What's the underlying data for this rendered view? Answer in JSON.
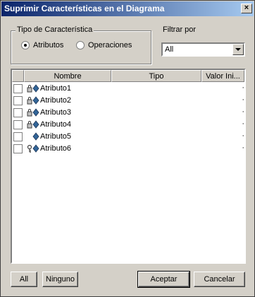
{
  "window": {
    "title": "Suprimir Características en el Diagrama",
    "close_label": "×"
  },
  "feature_type": {
    "label": "Tipo de Característica",
    "options": [
      {
        "label": "Atributos",
        "checked": true
      },
      {
        "label": "Operaciones",
        "checked": false
      }
    ]
  },
  "filter": {
    "label": "Filtrar por",
    "value": "All"
  },
  "list": {
    "columns": [
      "Nombre",
      "Tipo",
      "Valor Ini..."
    ],
    "rows": [
      {
        "name": "Atributo1",
        "icon": "locked-attribute-icon",
        "checked": false
      },
      {
        "name": "Atributo2",
        "icon": "locked-attribute-icon",
        "checked": false
      },
      {
        "name": "Atributo3",
        "icon": "locked-attribute-icon",
        "checked": false
      },
      {
        "name": "Atributo4",
        "icon": "locked-attribute-icon",
        "checked": false
      },
      {
        "name": "Atributo5",
        "icon": "attribute-icon",
        "checked": false
      },
      {
        "name": "Atributo6",
        "icon": "key-attribute-icon",
        "checked": false
      }
    ]
  },
  "buttons": {
    "all": "All",
    "none": "Ninguno",
    "accept": "Aceptar",
    "cancel": "Cancelar"
  },
  "colors": {
    "title_start": "#0a246a",
    "title_end": "#a6caf0",
    "attribute": "#336699"
  }
}
